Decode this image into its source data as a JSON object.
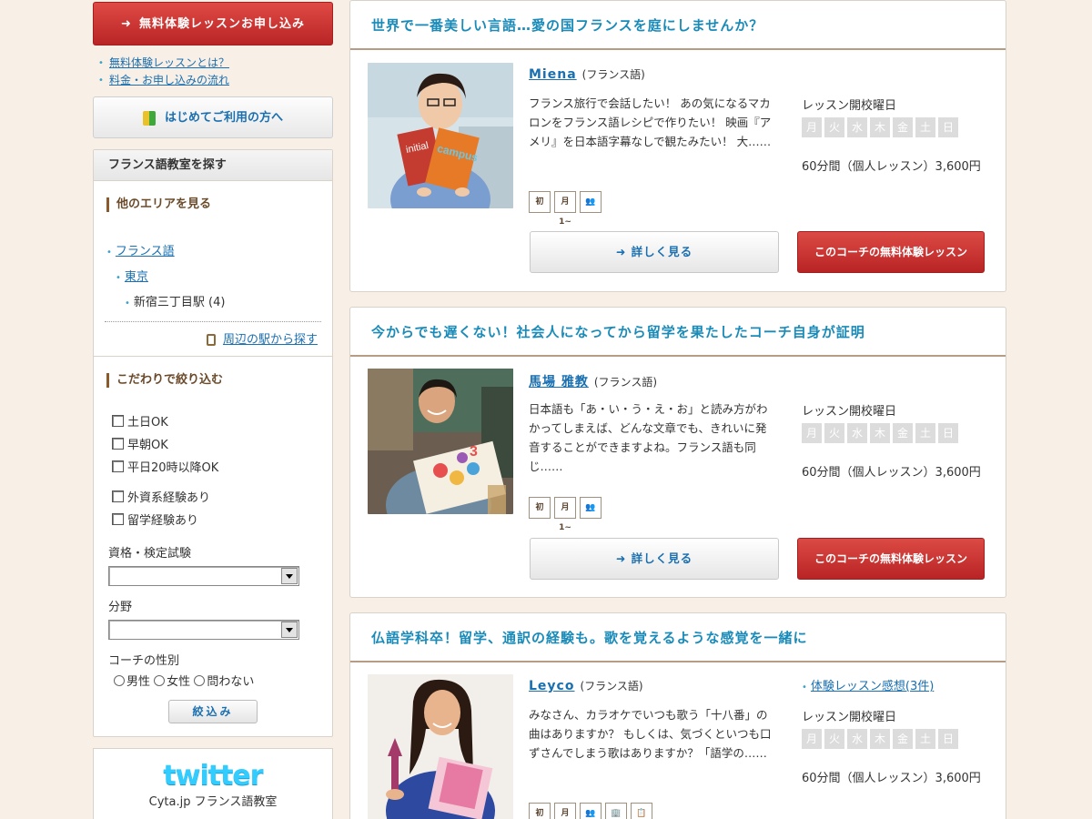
{
  "sidebar": {
    "trial_button": "無料体験レッスンお申し込み",
    "links": [
      "無料体験レッスンとは？",
      "料金・お申し込みの流れ"
    ],
    "first_time": "はじめてご利用の方へ",
    "search_panel": {
      "title": "フランス語教室を探す",
      "other_areas": "他のエリアを見る",
      "area_level1": "フランス語",
      "area_level2": "東京",
      "area_level3": "新宿三丁目駅 (4)",
      "nearby": "周辺の駅から探す"
    },
    "filter": {
      "title": "こだわりで絞り込む",
      "checks": [
        "土日OK",
        "早朝OK",
        "平日20時以降OK",
        "外資系経験あり",
        "留学経験あり"
      ],
      "exam_label": "資格・検定試験",
      "field_label": "分野",
      "gender_label": "コーチの性別",
      "gender_options": [
        "男性",
        "女性",
        "問わない"
      ],
      "submit": "絞込み"
    },
    "twitter": {
      "logo": "twitter",
      "caption": "Cyta.jp フランス語教室"
    }
  },
  "common": {
    "lesson_days_label": "レッスン開校曜日",
    "days": [
      "月",
      "火",
      "水",
      "木",
      "金",
      "土",
      "日"
    ],
    "detail_button": "詳しく見る",
    "trial_button": "このコーチの無料体験レッスン",
    "lang": "(フランス語)"
  },
  "coaches": [
    {
      "headline": "世界で一番美しい言語…愛の国フランスを庭にしませんか？",
      "name": "Miena",
      "description": "フランス旅行で会話したい！ あの気になるマカロンをフランス語レシピで作りたい！ 映画『アメリ』を日本語字幕なしで観たみたい！ 大……",
      "price": "60分間（個人レッスン）3,600円",
      "badges": [
        "初",
        "月1~",
        "👥"
      ]
    },
    {
      "headline": "今からでも遅くない！社会人になってから留学を果たしたコーチ自身が証明",
      "name": "馬場 雅教",
      "description": "日本語も「あ・い・う・え・お」と読み方がわかってしまえば、どんな文章でも、きれいに発音することができますよね。フランス語も同じ……",
      "price": "60分間（個人レッスン）3,600円",
      "badges": [
        "初",
        "月1~",
        "👥"
      ]
    },
    {
      "headline": "仏語学科卒！留学、通訳の経験も。歌を覚えるような感覚を一緒に",
      "name": "Leyco",
      "review": "体験レッスン感想(3件)",
      "description": "みなさん、カラオケでいつも歌う「十八番」の曲はありますか？ もしくは、気づくといつも口ずさんでしまう歌はありますか？「語学の……",
      "price": "60分間（個人レッスン）3,600円",
      "badges": [
        "初",
        "月1~",
        "👥",
        "🏢",
        "📋"
      ]
    }
  ]
}
